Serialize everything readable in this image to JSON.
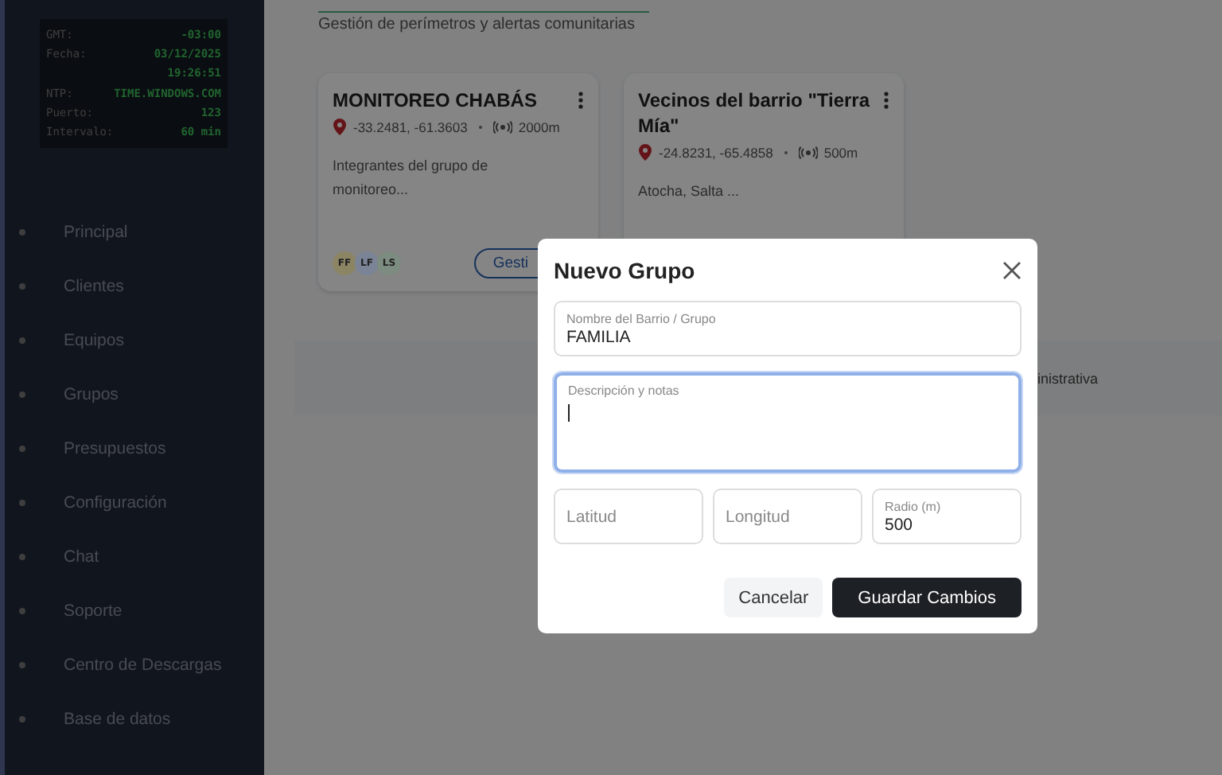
{
  "clock": [
    {
      "label": "GMT:",
      "value": "-03:00"
    },
    {
      "label": "Fecha:",
      "value": "03/12/2025"
    },
    {
      "value": "19:26:51"
    },
    {
      "label": "NTP:",
      "value": "TIME.WINDOWS.COM"
    },
    {
      "label": "Puerto:",
      "value": "123"
    },
    {
      "label": "Intervalo:",
      "value": "60 min"
    }
  ],
  "sidebar": {
    "items": [
      "Principal",
      "Clientes",
      "Equipos",
      "Grupos",
      "Presupuestos",
      "Configuración",
      "Chat",
      "Soporte",
      "Centro de Descargas",
      "Base de datos"
    ]
  },
  "page": {
    "subtitle": "Gestión de perímetros y alertas comunitarias"
  },
  "groups": [
    {
      "title": "MONITOREO CHABÁS",
      "coords": "-33.2481, -61.3603",
      "radius": "2000m",
      "description": "Integrantes del grupo de monitoreo...",
      "members": [
        {
          "initials": "FF",
          "color": "#8c8564"
        },
        {
          "initials": "LF",
          "color": "#7a8496"
        },
        {
          "initials": "LS",
          "color": "#7c8c80"
        }
      ],
      "action": "Gesti"
    },
    {
      "title": "Vecinos del barrio \"Tierra Mía\"",
      "coords": "-24.8231, -65.4858",
      "radius": "500m",
      "description": "Atocha, Salta ..."
    }
  ],
  "band": {
    "text": "inistrativa"
  },
  "dialog": {
    "title": "Nuevo Grupo",
    "fields": [
      {
        "kind": "input",
        "label": "Nombre del Barrio / Grupo",
        "value": "FAMILIA",
        "focused": false
      },
      {
        "kind": "textarea",
        "label": "Descripción y notas",
        "focused": true
      },
      {
        "kind": "input",
        "placeholder": "Latitud",
        "focused": false
      },
      {
        "kind": "input",
        "placeholder": "Longitud",
        "focused": false
      },
      {
        "kind": "input",
        "label": "Radio (m)",
        "value": "500",
        "focused": false
      }
    ],
    "buttons": [
      {
        "label": "Cancelar",
        "primary": false
      },
      {
        "label": "Guardar Cambios",
        "primary": true
      }
    ]
  }
}
